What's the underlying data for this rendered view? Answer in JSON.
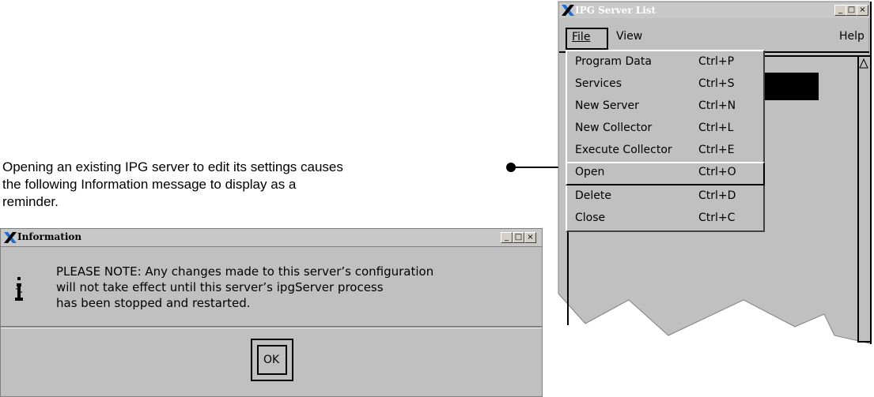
{
  "annotation": {
    "line1": "Opening an existing IPG server to edit its settings causes",
    "line2": "the following Information message to display as a",
    "line3": "reminder."
  },
  "server_window": {
    "title": "IPG Server List",
    "menubar": {
      "file_label": "File",
      "view_label": "View",
      "help_label": "Help"
    },
    "file_menu": [
      {
        "label": "Program Data",
        "accel": "Ctrl+P"
      },
      {
        "label": "Services",
        "accel": "Ctrl+S"
      },
      {
        "label": "New Server",
        "accel": "Ctrl+N"
      },
      {
        "label": "New Collector",
        "accel": "Ctrl+L"
      },
      {
        "label": "Execute Collector",
        "accel": "Ctrl+E"
      },
      {
        "label": "Open",
        "accel": "Ctrl+O"
      },
      {
        "label": "Delete",
        "accel": "Ctrl+D"
      },
      {
        "label": "Close",
        "accel": "Ctrl+C"
      }
    ]
  },
  "info_dialog": {
    "title": "Information",
    "message_line1": "PLEASE NOTE: Any changes made to this server’s configuration",
    "message_line2": "will not take effect until this server’s ipgServer process",
    "message_line3": "has been stopped and restarted.",
    "ok_label": "OK"
  },
  "colors": {
    "window_bg": "#c0c0c0",
    "selection": "#000000",
    "x_logo_blue": "#1f6fd0"
  }
}
